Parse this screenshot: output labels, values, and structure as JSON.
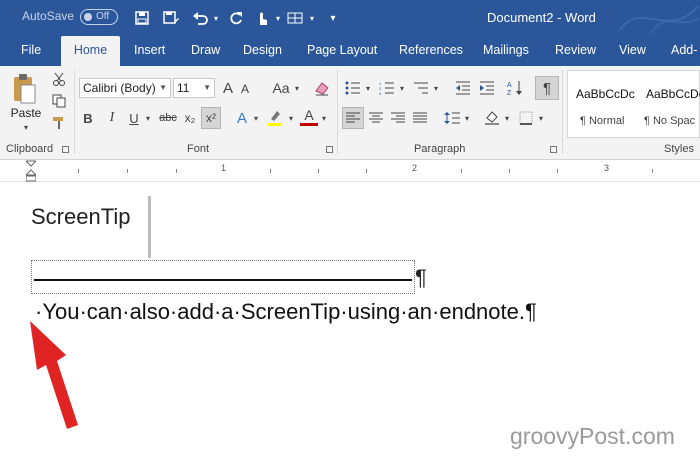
{
  "titlebar": {
    "autosave_label": "AutoSave",
    "autosave_state": "Off",
    "document_title": "Document2 - Word",
    "qat_icons": [
      "save-icon",
      "save-as-icon",
      "undo-icon",
      "redo-icon",
      "touch-mode-icon",
      "table-icon",
      "customize-icon"
    ]
  },
  "tabs": [
    {
      "label": "File"
    },
    {
      "label": "Home",
      "active": true
    },
    {
      "label": "Insert"
    },
    {
      "label": "Draw"
    },
    {
      "label": "Design"
    },
    {
      "label": "Page Layout"
    },
    {
      "label": "References"
    },
    {
      "label": "Mailings"
    },
    {
      "label": "Review"
    },
    {
      "label": "View"
    },
    {
      "label": "Add-"
    }
  ],
  "ribbon": {
    "clipboard": {
      "paste_label": "Paste",
      "group_label": "Clipboard"
    },
    "font": {
      "font_name": "Calibri (Body)",
      "font_size": "11",
      "group_label": "Font",
      "grow_label": "A",
      "shrink_label": "A",
      "case_label": "Aa",
      "bold": "B",
      "italic": "I",
      "underline": "U",
      "strikethrough": "abc",
      "subscript": "x₂",
      "superscript": "x²",
      "effects_label": "A",
      "color_label": "A"
    },
    "paragraph": {
      "group_label": "Paragraph",
      "pilcrow": "¶"
    },
    "styles": {
      "group_label": "Styles",
      "items": [
        {
          "preview": "AaBbCcDc",
          "name": "¶ Normal"
        },
        {
          "preview": "AaBbCcDc",
          "name": "¶ No Spac"
        }
      ]
    }
  },
  "ruler": {
    "numbers": [
      "1",
      "2",
      "3"
    ]
  },
  "document": {
    "screentip": "ScreenTip",
    "separator_pilcrow": "¶",
    "endnote_text": "·You·can·also·add·a·ScreenTip·using·an·endnote.¶"
  },
  "watermark": "groovyPost.com",
  "colors": {
    "brand": "#2b579a",
    "ribbon": "#f3f3f3",
    "arrow": "#e02424"
  }
}
